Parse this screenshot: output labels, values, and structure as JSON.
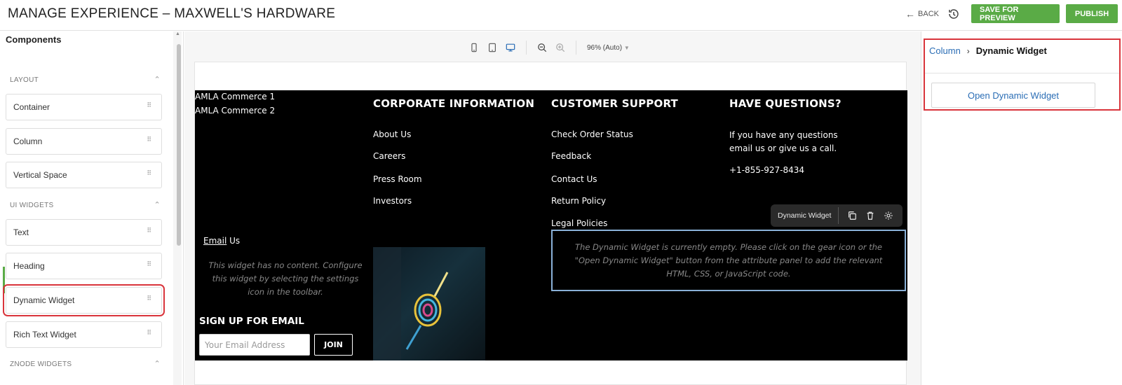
{
  "header": {
    "title": "MANAGE EXPERIENCE – MAXWELL'S HARDWARE",
    "back_label": "BACK",
    "save_preview_label": "SAVE FOR PREVIEW",
    "publish_label": "PUBLISH",
    "accent_color": "#5aab46"
  },
  "components_panel": {
    "title": "Components",
    "sections": [
      {
        "label": "LAYOUT",
        "items": [
          "Container",
          "Column",
          "Vertical Space"
        ]
      },
      {
        "label": "UI WIDGETS",
        "items": [
          "Text",
          "Heading",
          "Dynamic Widget",
          "Rich Text Widget"
        ]
      },
      {
        "label": "ZNODE WIDGETS",
        "items": []
      }
    ],
    "selected_item": "Dynamic Widget"
  },
  "canvas": {
    "zoom_label": "96% (Auto)",
    "footer": {
      "amla_lines": [
        "AMLA Commerce 1",
        "AMLA Commerce 2"
      ],
      "columns": [
        {
          "heading": "CORPORATE INFORMATION",
          "links": [
            "About Us",
            "Careers",
            "Press Room",
            "Investors"
          ]
        },
        {
          "heading": "CUSTOMER SUPPORT",
          "links": [
            "Check Order Status",
            "Feedback",
            "Contact Us",
            "Return Policy",
            "Legal Policies"
          ]
        },
        {
          "heading": "HAVE QUESTIONS?",
          "text": "If you have any questions email us or give us a call.",
          "phone": "+1-855-927-8434"
        }
      ],
      "email_us_link": "Email",
      "email_us_rest": " Us",
      "empty_widget_note": "This widget has no content. Configure this widget by selecting the settings icon in the toolbar.",
      "signup_title": "SIGN UP FOR EMAIL",
      "email_placeholder": "Your Email Address",
      "join_label": "JOIN"
    },
    "widget_toolbar_label": "Dynamic Widget",
    "dynamic_widget_message": "The Dynamic Widget is currently empty. Please click on the gear icon or the \"Open Dynamic Widget\" button from the attribute panel to add the relevant HTML, CSS, or JavaScript code."
  },
  "attribute_panel": {
    "breadcrumb_parent": "Column",
    "breadcrumb_current": "Dynamic Widget",
    "open_button_label": "Open Dynamic Widget"
  }
}
